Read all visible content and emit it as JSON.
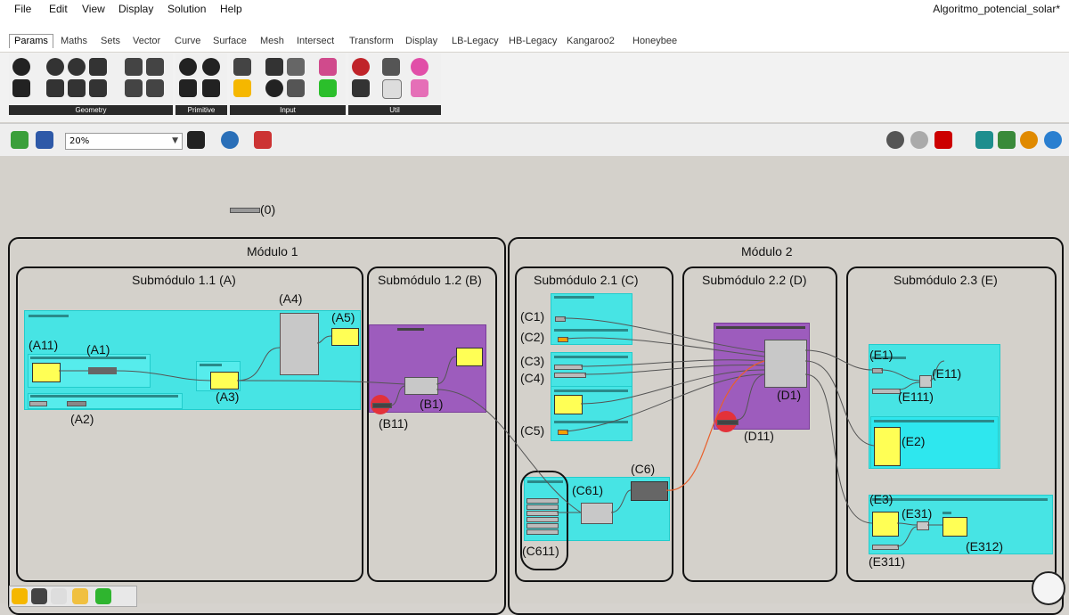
{
  "menu": [
    "File",
    "Edit",
    "View",
    "Display",
    "Solution",
    "Help"
  ],
  "doc_title": "Algoritmo_potencial_solar*",
  "tabs": [
    "Params",
    "Maths",
    "Sets",
    "Vector",
    "Curve",
    "Surface",
    "Mesh",
    "Intersect",
    "Transform",
    "Display",
    "LB-Legacy",
    "HB-Legacy",
    "Kangaroo2",
    "Honeybee"
  ],
  "ribbon_groups": [
    "Geometry",
    "Primitive",
    "Input",
    "Util"
  ],
  "zoom": "20%",
  "canvas": {
    "scribble_0": "(0)",
    "modulo1": "Módulo 1",
    "modulo2": "Módulo 2",
    "sub11": "Submódulo 1.1 (A)",
    "sub12": "Submódulo 1.2 (B)",
    "sub21": "Submódulo 2.1 (C)",
    "sub22": "Submódulo 2.2 (D)",
    "sub23": "Submódulo 2.3 (E)",
    "labels": {
      "A4": "(A4)",
      "A5": "(A5)",
      "A11": "(A11)",
      "A1": "(A1)",
      "A3": "(A3)",
      "A2": "(A2)",
      "B1": "(B1)",
      "B11": "(B11)",
      "C1": "(C1)",
      "C2": "(C2)",
      "C3": "(C3)",
      "C4": "(C4)",
      "C5": "(C5)",
      "C6": "(C6)",
      "C61": "(C61)",
      "C611": "(C611)",
      "D1": "(D1)",
      "D11": "(D11)",
      "E1": "(E1)",
      "E11": "(E11)",
      "E111": "(E111)",
      "E2": "(E2)",
      "E3": "(E3)",
      "E31": "(E31)",
      "E312": "(E312)",
      "E311": "(E311)"
    }
  },
  "colors": {
    "group_cyan": "#47e4e4",
    "group_purple": "#9d5cbd",
    "panel_yellow": "#ffff55",
    "wire_orange": "#e8602c"
  }
}
